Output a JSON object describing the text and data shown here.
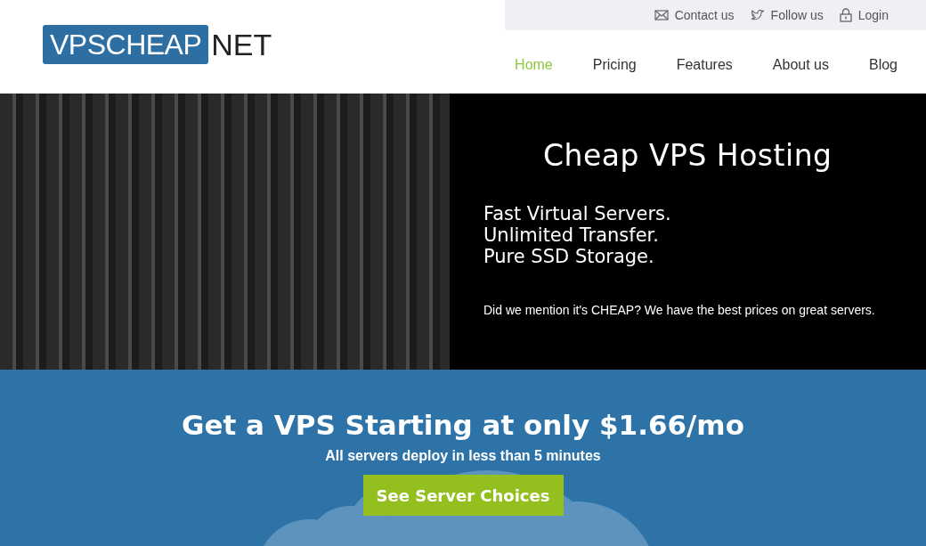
{
  "logo": {
    "boxed": "VPSCHEAP",
    "plain": "NET"
  },
  "top_links": [
    {
      "kind": "mail",
      "label": "Contact us"
    },
    {
      "kind": "bird",
      "label": "Follow us"
    },
    {
      "kind": "lock",
      "label": "Login"
    }
  ],
  "nav": [
    {
      "label": "Home",
      "selected": true
    },
    {
      "label": "Pricing",
      "selected": false
    },
    {
      "label": "Features",
      "selected": false
    },
    {
      "label": "About us",
      "selected": false
    },
    {
      "label": "Blog",
      "selected": false
    }
  ],
  "hero": {
    "title": "Cheap VPS Hosting",
    "features": [
      "Fast Virtual Servers.",
      "Unlimited Transfer.",
      "Pure SSD Storage."
    ],
    "note": "Did we mention it's CHEAP? We have the best prices on great servers."
  },
  "promo": {
    "headline": "Get a VPS Starting at only $1.66/mo",
    "subline": "All servers deploy in less than 5 minutes",
    "button": "See Server Choices"
  }
}
